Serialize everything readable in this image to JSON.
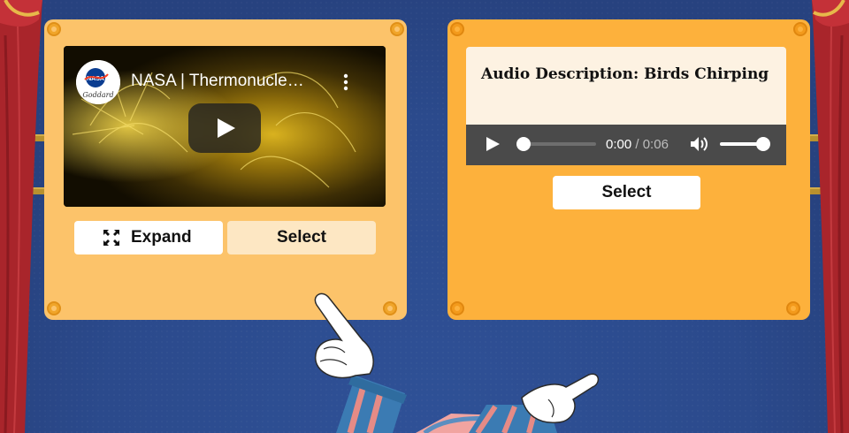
{
  "video": {
    "title": "NASA | Thermonucle…",
    "channel_logo_text": "NASA Goddard",
    "play_icon": "play-icon",
    "menu_icon": "kebab-menu-icon"
  },
  "left_card": {
    "expand_label": "Expand",
    "expand_icon": "expand-icon",
    "select_label": "Select"
  },
  "right_card": {
    "audio_title": "Audio Description: Birds Chirping",
    "current_time": "0:00",
    "separator": "/",
    "duration": "0:06",
    "progress": 0.0,
    "volume": 1.0,
    "select_label": "Select"
  },
  "colors": {
    "background": "#2b4a8c",
    "frame_left": "#fcc36a",
    "frame_right": "#fdb13c",
    "curtain": "#a9252b",
    "audio_bar": "#4a4a4a"
  }
}
